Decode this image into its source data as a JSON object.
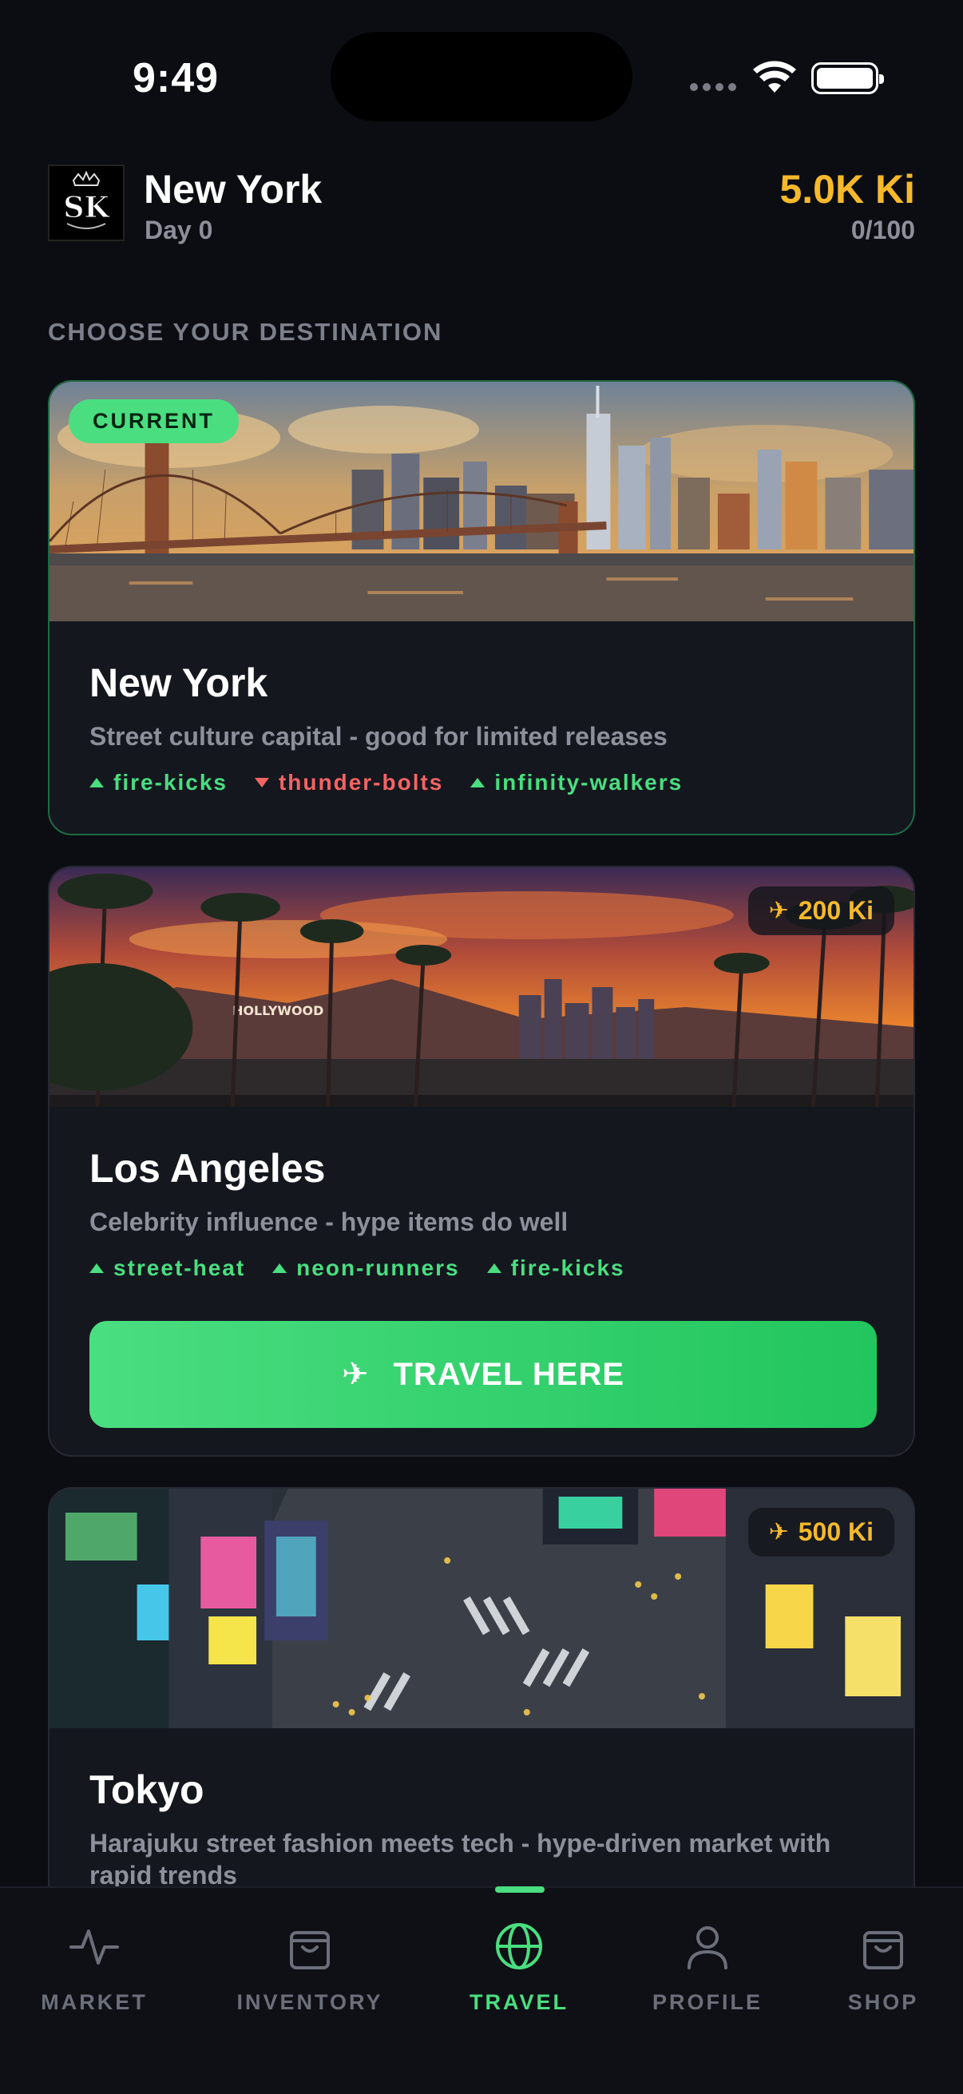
{
  "status": {
    "time": "9:49"
  },
  "header": {
    "city": "New York",
    "day": "Day 0",
    "balance": "5.0K Ki",
    "capacity": "0/100",
    "logo_text": "SK"
  },
  "section_title": "CHOOSE YOUR DESTINATION",
  "destinations": [
    {
      "name": "New York",
      "description": "Street culture capital - good for limited releases",
      "badge": "CURRENT",
      "tags": [
        {
          "label": "fire-kicks",
          "trend": "up"
        },
        {
          "label": "thunder-bolts",
          "trend": "down"
        },
        {
          "label": "infinity-walkers",
          "trend": "up"
        }
      ]
    },
    {
      "name": "Los Angeles",
      "description": "Celebrity influence - hype items do well",
      "cost": "200 Ki",
      "image_sign": "HOLLYWOOD",
      "tags": [
        {
          "label": "street-heat",
          "trend": "up"
        },
        {
          "label": "neon-runners",
          "trend": "up"
        },
        {
          "label": "fire-kicks",
          "trend": "up"
        }
      ],
      "button_label": "TRAVEL HERE"
    },
    {
      "name": "Tokyo",
      "description": "Harajuku street fashion meets tech - hype-driven market with rapid trends",
      "cost": "500 Ki"
    }
  ],
  "nav": {
    "items": [
      {
        "label": "MARKET",
        "icon": "activity-icon"
      },
      {
        "label": "INVENTORY",
        "icon": "bag-icon"
      },
      {
        "label": "TRAVEL",
        "icon": "globe-icon",
        "active": true
      },
      {
        "label": "PROFILE",
        "icon": "user-icon"
      },
      {
        "label": "SHOP",
        "icon": "bag-icon"
      }
    ]
  },
  "colors": {
    "accent": "#4ade80",
    "gold": "#f6b92c",
    "negative": "#f26464",
    "background": "#0c0d12"
  }
}
